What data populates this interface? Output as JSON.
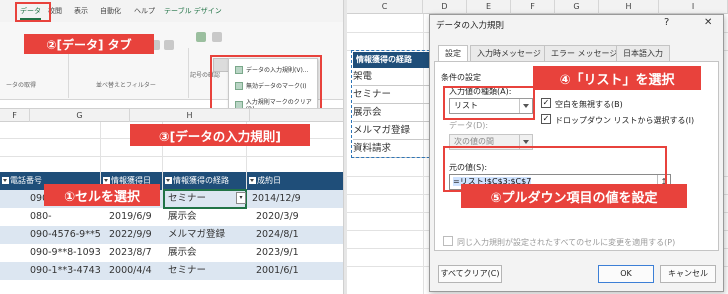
{
  "left": {
    "ribbon_tabs": [
      "データ",
      "校閲",
      "表示",
      "自動化",
      "ヘルプ",
      "テーブル デザイン"
    ],
    "ribbon_groups": [
      "ータの取得",
      "並べ替えとフィルター",
      "記号の確認"
    ],
    "menu_items": [
      "データの入力規則(V)...",
      "無効データのマーク(I)",
      "入力規則マークのクリア(R)"
    ],
    "column_headers": [
      "F",
      "G",
      "H"
    ],
    "table_headers": [
      "電話番号",
      "情報獲得日",
      "情報獲得の経路",
      "成約日"
    ],
    "rows": [
      {
        "phone": "090-",
        "date": "",
        "route": "セミナー",
        "contract": "2014/12/9"
      },
      {
        "phone": "080-",
        "date": "2019/6/9",
        "route": "展示会",
        "contract": "2020/3/9"
      },
      {
        "phone": "090-4576-9**5",
        "date": "2022/9/9",
        "route": "メルマガ登録",
        "contract": "2024/8/1"
      },
      {
        "phone": "090-9**8-1093",
        "date": "2023/8/7",
        "route": "展示会",
        "contract": "2023/9/1"
      },
      {
        "phone": "090-1**3-4743",
        "date": "2000/4/4",
        "route": "セミナー",
        "contract": "2001/6/1"
      }
    ],
    "callouts": {
      "step2": "②[データ] タブ",
      "step3": "③[データの入力規則]",
      "step1": "①セルを選択"
    }
  },
  "right": {
    "column_headers": [
      "C",
      "D",
      "E",
      "F",
      "G",
      "H",
      "I"
    ],
    "list_header": "情報獲得の経路",
    "list_items": [
      "架電",
      "セミナー",
      "展示会",
      "メルマガ登録",
      "資料請求"
    ],
    "dialog": {
      "title": "データの入力規則",
      "help": "?",
      "close": "✕",
      "tabs": [
        "設定",
        "入力時メッセージ",
        "エラー メッセージ",
        "日本語入力"
      ],
      "condition_label": "条件の設定",
      "allow_label": "入力値の種類(A):",
      "allow_value": "リスト",
      "data_label": "データ(D):",
      "data_value": "次の値の間",
      "ignore_blank": "空白を無視する(B)",
      "in_cell_dropdown": "ドロップダウン リストから選択する(I)",
      "source_label": "元の値(S):",
      "source_value": "=リスト!$C$3:$C$7",
      "upload_icon": "↥",
      "apply_all": "同じ入力規則が設定されたすべてのセルに変更を適用する(P)",
      "clear_all": "すべてクリア(C)",
      "ok": "OK",
      "cancel": "キャンセル"
    },
    "callouts": {
      "step4": "④「リスト」を選択",
      "step5": "⑤プルダウン項目の値を設定"
    }
  },
  "colors": {
    "callout_red": "#e8423c",
    "excel_green": "#217346",
    "table_header_navy": "#1f4e79",
    "row_band": "#dce6f1"
  }
}
